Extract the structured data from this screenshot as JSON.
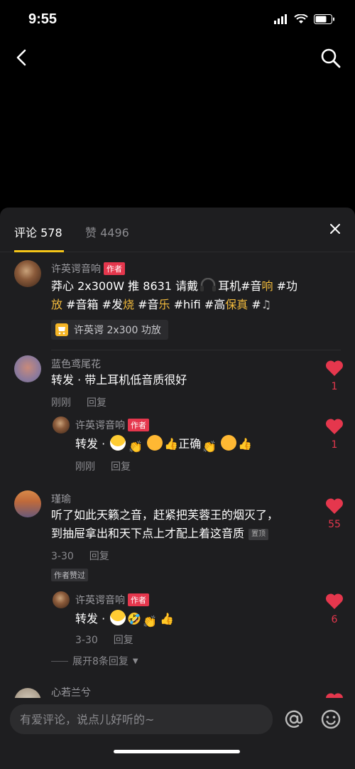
{
  "status": {
    "time": "9:55"
  },
  "tabs": {
    "comments_label": "评论 578",
    "likes_label": "赞 4496"
  },
  "comments": [
    {
      "user": "许英谔音响",
      "tag": "作者",
      "text_line1": [
        "莽心 2x300W 推 8631 请戴",
        "耳机#音",
        "响",
        " #功"
      ],
      "text_line2": [
        "放",
        " #音箱 #发",
        "烧",
        " #音",
        "乐",
        " #hifi #高",
        "保真",
        " #"
      ],
      "product": "许英谔 2x300 功放"
    },
    {
      "user": "蓝色鸢尾花",
      "text": "转发 · 带上耳机低音质很好",
      "time": "刚刚",
      "reply": "回复",
      "likes": "1",
      "sub": {
        "user": "许英谔音响",
        "tag": "作者",
        "text_prefix": "转发 · ",
        "text_mid": "正确",
        "time": "刚刚",
        "reply": "回复",
        "likes": "1"
      }
    },
    {
      "user": "瑾瑜",
      "text_line1": "听了如此天籁之音，赶紧把芙蓉王的烟灭了，",
      "text_line2": "到抽屉拿出和天下点上才配上着这音质",
      "pin": "置顶",
      "time": "3-30",
      "reply": "回复",
      "likes": "55",
      "liked_by_author": "作者赞过",
      "sub": {
        "user": "许英谔音响",
        "tag": "作者",
        "text_prefix": "转发 · ",
        "time": "3-30",
        "reply": "回复",
        "likes": "6"
      },
      "expand": "展开8条回复"
    },
    {
      "user": "心若兰兮"
    }
  ],
  "input": {
    "placeholder": "有爱评论，说点儿好听的~"
  },
  "colors": {
    "accent": "#f5c518",
    "like": "#e5374d",
    "highlight": "#f0b93c",
    "sheet": "#1e1e20"
  }
}
